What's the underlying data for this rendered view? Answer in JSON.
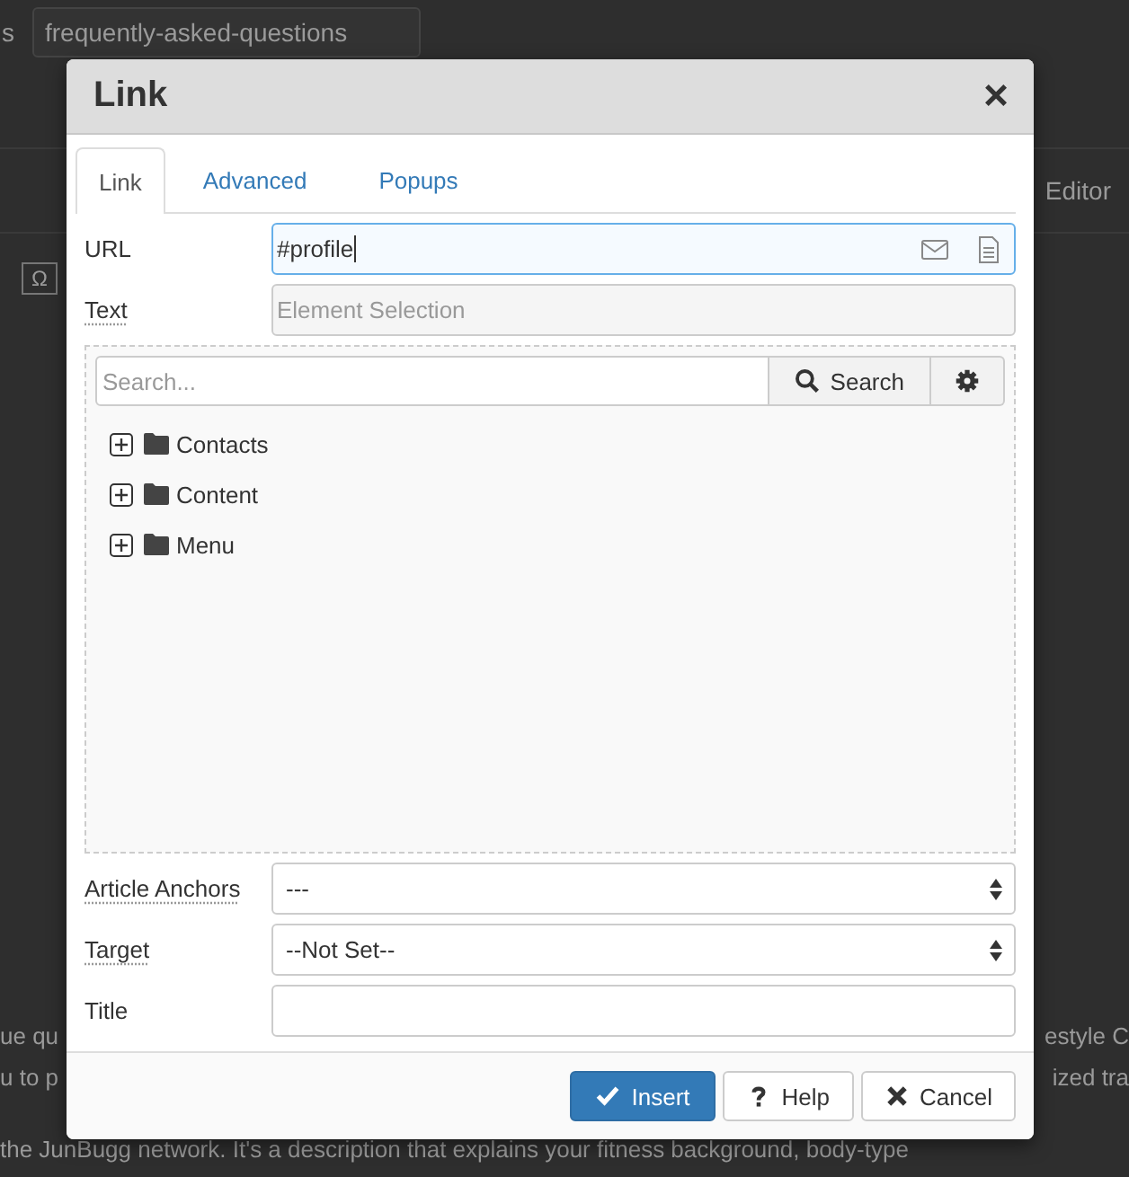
{
  "background": {
    "field_label": "s",
    "field_value": "frequently-asked-questions",
    "toolbar_label": "Editor",
    "toolbar_button": "Ω",
    "text_left": [
      "ue qu",
      "u to p"
    ],
    "text_right": [
      "estyle C",
      "ized tra"
    ],
    "text_bottom": "the JunBugg network. It's a description that explains your fitness background, body-type"
  },
  "dialog": {
    "title": "Link",
    "close": "×",
    "tabs": [
      {
        "label": "Link",
        "selected": true
      },
      {
        "label": "Advanced",
        "selected": false
      },
      {
        "label": "Popups",
        "selected": false
      }
    ],
    "url": {
      "label": "URL",
      "tooltip": false,
      "value": "#profile"
    },
    "text": {
      "label": "Text",
      "tooltip": true,
      "placeholder": "Element Selection"
    },
    "browser": {
      "search_placeholder": "Search...",
      "search_button": "Search",
      "tree": [
        {
          "label": "Contacts",
          "expanded": false
        },
        {
          "label": "Content",
          "expanded": false
        },
        {
          "label": "Menu",
          "expanded": false
        }
      ]
    },
    "article_anchors": {
      "label": "Article Anchors",
      "tooltip": true,
      "value": "---"
    },
    "target": {
      "label": "Target",
      "tooltip": true,
      "value": "--Not Set--"
    },
    "title_field": {
      "label": "Title",
      "tooltip": false
    },
    "buttons": [
      {
        "label": "Insert",
        "kind": "insert"
      },
      {
        "label": "Help",
        "kind": "help"
      },
      {
        "label": "Cancel",
        "kind": "cancel"
      }
    ]
  }
}
